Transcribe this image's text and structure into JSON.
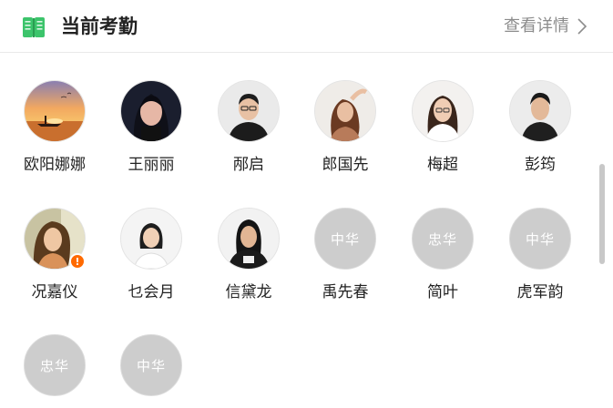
{
  "header": {
    "title": "当前考勤",
    "link_label": "查看详情",
    "icon": "book-icon",
    "accent": "#3cc46b"
  },
  "members": [
    {
      "name": "欧阳娜娜",
      "avatar": "sunset-photo"
    },
    {
      "name": "王丽丽",
      "avatar": "photo"
    },
    {
      "name": "邴启",
      "avatar": "photo"
    },
    {
      "name": "郎国先",
      "avatar": "photo"
    },
    {
      "name": "梅超",
      "avatar": "photo"
    },
    {
      "name": "彭筠",
      "avatar": "photo"
    },
    {
      "name": "况嘉仪",
      "avatar": "photo",
      "badge": "!"
    },
    {
      "name": "乜会月",
      "avatar": "photo"
    },
    {
      "name": "信黛龙",
      "avatar": "photo"
    },
    {
      "name": "禹先春",
      "avatar": "placeholder",
      "placeholder_text": "中华"
    },
    {
      "name": "简叶",
      "avatar": "placeholder",
      "placeholder_text": "忠华"
    },
    {
      "name": "虎军韵",
      "avatar": "placeholder",
      "placeholder_text": "中华"
    },
    {
      "name": "",
      "avatar": "placeholder",
      "placeholder_text": "忠华"
    },
    {
      "name": "",
      "avatar": "placeholder",
      "placeholder_text": "中华"
    }
  ],
  "colors": {
    "placeholder_bg": "#cdcdcd",
    "warning_badge": "#ff6a00"
  }
}
